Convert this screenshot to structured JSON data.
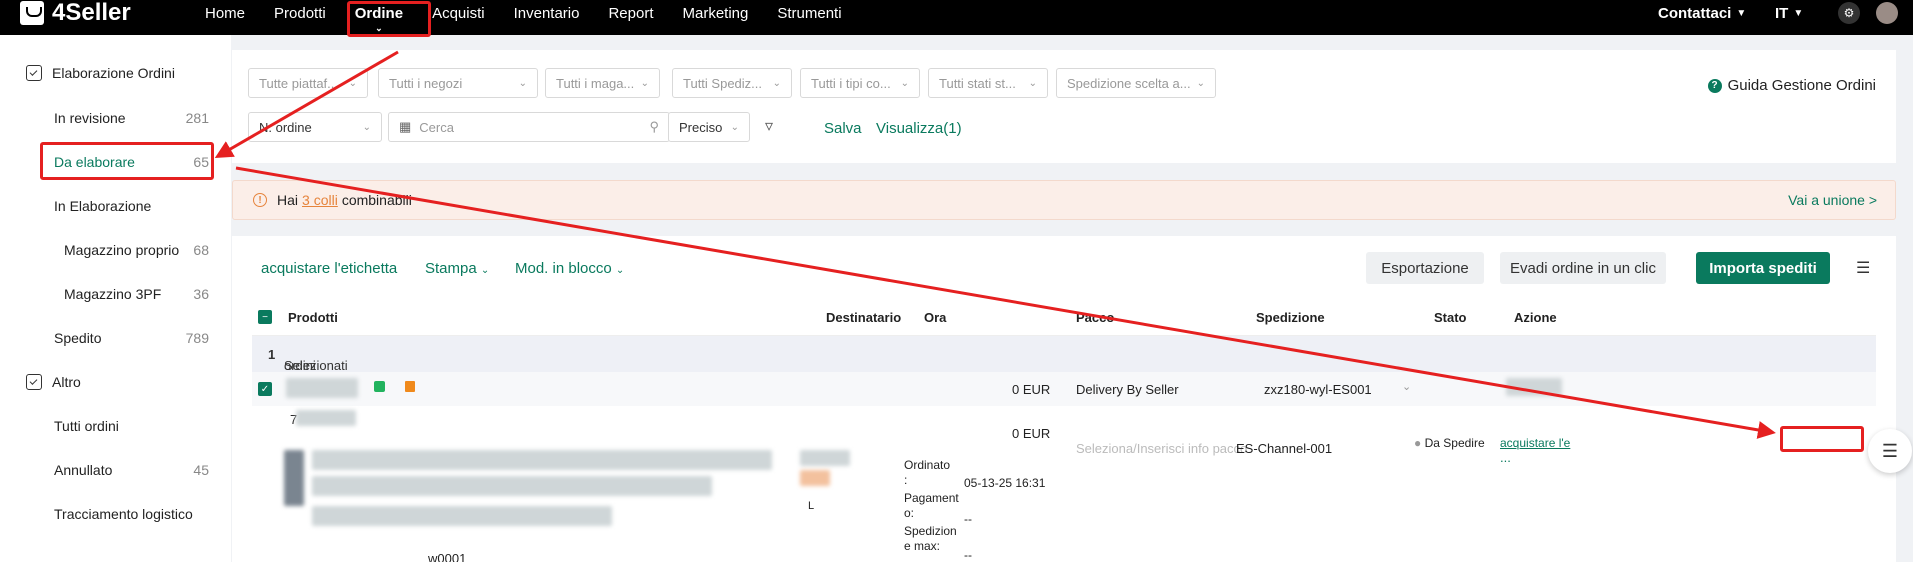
{
  "app": {
    "logo": "4Seller"
  },
  "nav": {
    "items": [
      "Home",
      "Prodotti",
      "Ordine",
      "Acquisti",
      "Inventario",
      "Report",
      "Marketing",
      "Strumenti"
    ],
    "active": "Ordine",
    "contact": "Contattaci",
    "lang": "IT"
  },
  "sidebar": {
    "group1": "Elaborazione Ordini",
    "in_revisione": {
      "label": "In revisione",
      "count": "281"
    },
    "da_elaborare": {
      "label": "Da elaborare",
      "count": "65"
    },
    "in_elaborazione": {
      "label": "In Elaborazione"
    },
    "magazzino_proprio": {
      "label": "Magazzino proprio",
      "count": "68"
    },
    "magazzino_3pf": {
      "label": "Magazzino 3PF",
      "count": "36"
    },
    "spedito": {
      "label": "Spedito",
      "count": "789"
    },
    "group2": "Altro",
    "tutti_ordini": {
      "label": "Tutti ordini"
    },
    "annullato": {
      "label": "Annullato",
      "count": "45"
    },
    "tracciamento": {
      "label": "Tracciamento logistico"
    }
  },
  "filters": {
    "platforms": "Tutte piattaf...",
    "stores": "Tutti i negozi",
    "warehouses": "Tutti i maga...",
    "shipping": "Tutti Spediz...",
    "types": "Tutti i tipi co...",
    "states": "Tutti stati st...",
    "chosen_shipping": "Spedizione scelta a...",
    "order_field": "N. ordine",
    "search_placeholder": "Cerca",
    "match": "Preciso",
    "save": "Salva",
    "view": "Visualizza(1)",
    "guide": "Guida Gestione Ordini"
  },
  "alert": {
    "prefix": "Hai",
    "link": "3 colli",
    "suffix": "combinabili",
    "action": "Vai a unione >"
  },
  "toolbar": {
    "buy_label": "acquistare l'etichetta",
    "print": "Stampa",
    "bulk": "Mod. in blocco",
    "export": "Esportazione",
    "one_click": "Evadi ordine in un clic",
    "import": "Importa spediti"
  },
  "table": {
    "headers": {
      "products": "Prodotti",
      "recipient": "Destinatario",
      "time": "Ora",
      "package": "Pacco",
      "shipping": "Spedizione",
      "status": "Stato",
      "action": "Azione"
    },
    "selected_prefix": "Selezionati",
    "selected_count": "1",
    "selected_suffix": "ordini",
    "row1": {
      "amount": "0 EUR",
      "package": "Delivery By Seller",
      "shipping": "zxz180-wyl-ES001"
    },
    "row2": {
      "id_prefix": "7",
      "amount": "0 EUR",
      "package_hint": "Seleziona/Inserisci info pacco",
      "channel": "ES-Channel-001",
      "status": "Da Spedire",
      "action": "acquistare l'e",
      "more": "...",
      "ordered_label": "Ordinato",
      "ordered_colon": ":",
      "ordered_value": "05-13-25 16:31",
      "pay_label": "Pagament",
      "pay_label2": "o:",
      "pay_value": "--",
      "max_label": "Spedizion",
      "max_label2": "e max:",
      "max_value": "--",
      "sku_tail": "w0001",
      "recipient_initial": "L"
    }
  }
}
